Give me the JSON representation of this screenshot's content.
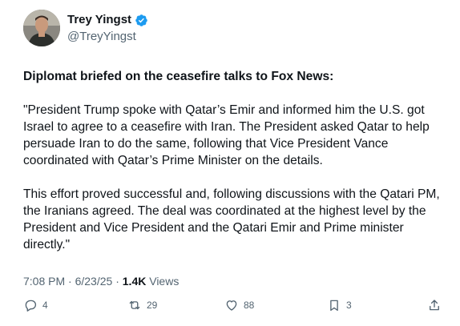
{
  "author": {
    "display_name": "Trey Yingst",
    "handle": "@TreyYingst"
  },
  "tweet": {
    "headline": "Diplomat briefed on the ceasefire talks to Fox News:",
    "paragraphs": [
      "\"President Trump spoke with Qatar’s Emir and informed him the U.S. got Israel to agree to a ceasefire with Iran. The President asked Qatar to help persuade Iran to do the same, following that Vice President Vance coordinated with Qatar’s Prime Minister on the details.",
      "This effort proved successful and, following discussions with the Qatari PM, the Iranians agreed. The deal was coordinated at the highest level by the President and Vice President and the Qatari Emir and Prime minister directly.\""
    ]
  },
  "meta": {
    "time": "7:08 PM",
    "separator": "·",
    "date": "6/23/25",
    "views_count": "1.4K",
    "views_label": "Views"
  },
  "actions": {
    "replies": "4",
    "reposts": "29",
    "likes": "88",
    "bookmarks": "3"
  },
  "icons": {
    "verified": "verified-badge-icon",
    "reply": "reply-icon",
    "repost": "repost-icon",
    "like": "heart-icon",
    "bookmark": "bookmark-icon",
    "share": "share-icon"
  },
  "colors": {
    "verified": "#1d9bf0",
    "text": "#0f1419",
    "secondary": "#536471"
  }
}
